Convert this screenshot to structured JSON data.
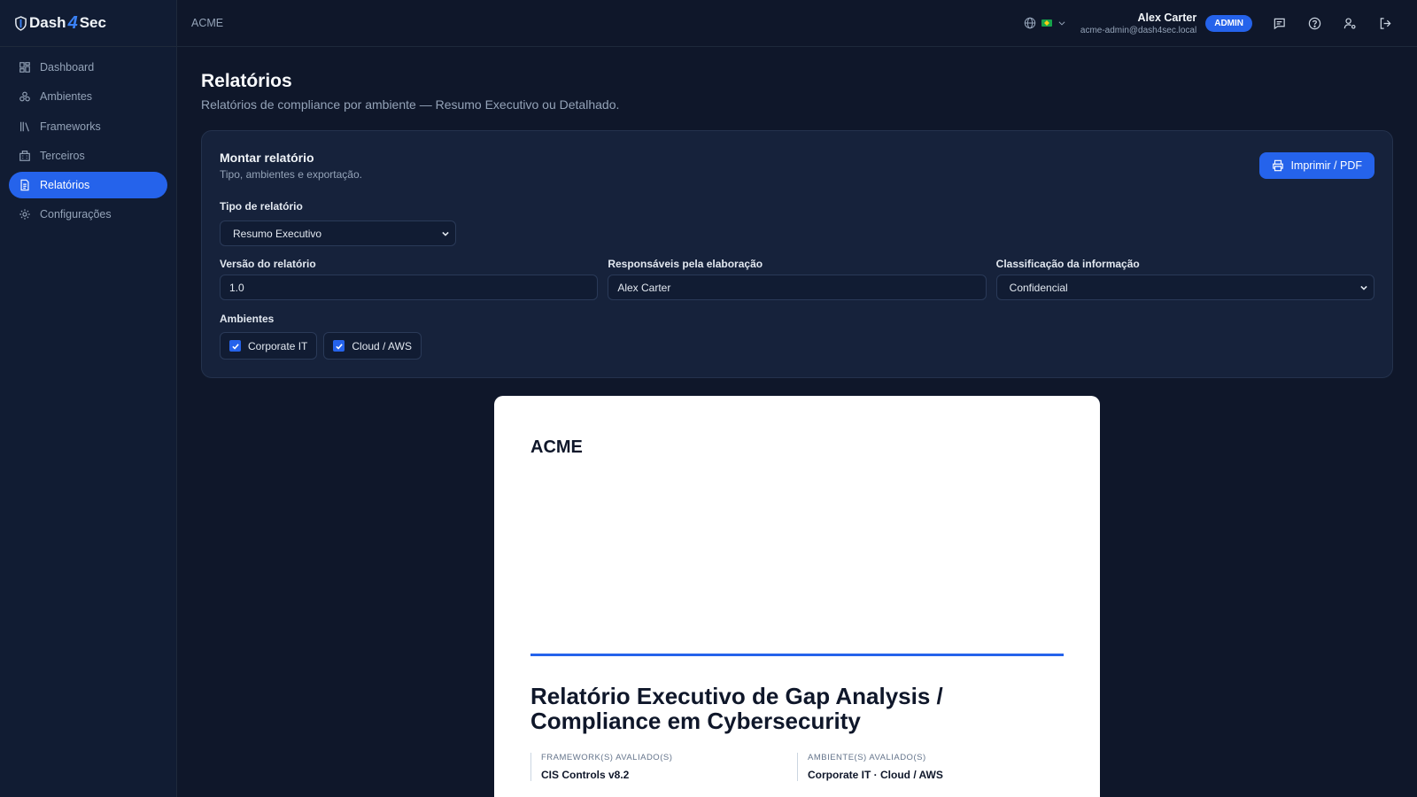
{
  "app": {
    "logo_left": "Dash",
    "logo_mid": "4",
    "logo_right": "Sec"
  },
  "sidebar": {
    "items": [
      {
        "label": "Dashboard",
        "icon": "grid-icon"
      },
      {
        "label": "Ambientes",
        "icon": "layers-icon"
      },
      {
        "label": "Frameworks",
        "icon": "library-icon"
      },
      {
        "label": "Terceiros",
        "icon": "building-icon"
      },
      {
        "label": "Relatórios",
        "icon": "file-icon",
        "active": true
      },
      {
        "label": "Configurações",
        "icon": "gear-icon"
      }
    ]
  },
  "header": {
    "org": "ACME",
    "user_name": "Alex Carter",
    "user_email": "acme-admin@dash4sec.local",
    "role_badge": "ADMIN"
  },
  "page": {
    "title": "Relatórios",
    "subtitle": "Relatórios de compliance por ambiente — Resumo Executivo ou Detalhado."
  },
  "builder": {
    "title": "Montar relatório",
    "subtitle": "Tipo, ambientes e exportação.",
    "print_label": "Imprimir / PDF",
    "type_label": "Tipo de relatório",
    "type_value": "Resumo Executivo",
    "version_label": "Versão do relatório",
    "version_value": "1.0",
    "owners_label": "Responsáveis pela elaboração",
    "owners_value": "Alex Carter",
    "class_label": "Classificação da informação",
    "class_value": "Confidencial",
    "envs_label": "Ambientes",
    "envs": [
      {
        "label": "Corporate IT",
        "checked": true
      },
      {
        "label": "Cloud / AWS",
        "checked": true
      }
    ]
  },
  "preview": {
    "org": "ACME",
    "title_line1": "Relatório Executivo de Gap Analysis /",
    "title_line2": "Compliance em Cybersecurity",
    "framework_label": "FRAMEWORK(S) AVALIADO(S)",
    "framework_value": "CIS Controls v8.2",
    "envs_label": "AMBIENTE(S) AVALIADO(S)",
    "envs_value": "Corporate IT · Cloud / AWS"
  },
  "colors": {
    "accent": "#2563eb",
    "background": "#0f172a",
    "sidebar": "#111c33",
    "card": "#16223b"
  }
}
